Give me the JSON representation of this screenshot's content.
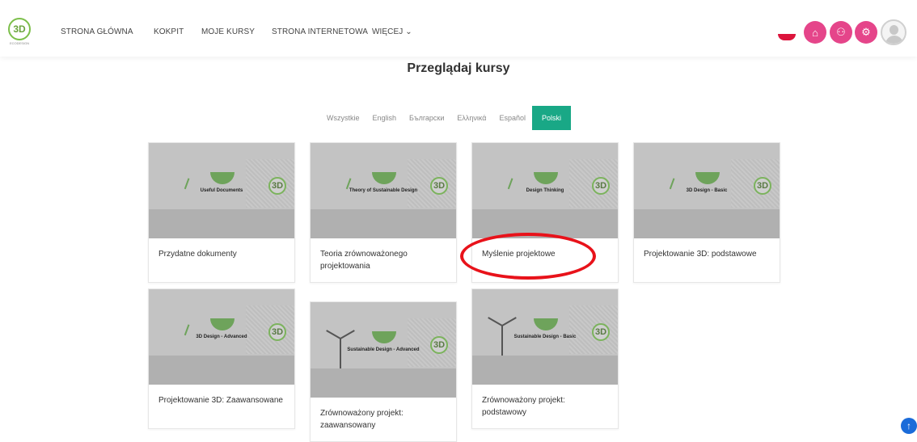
{
  "logo": {
    "text": "3D",
    "tagline": "ECODESIGN"
  },
  "nav": {
    "home": "STRONA GŁÓWNA",
    "dashboard": "KOKPIT",
    "my_courses": "MOJE KURSY",
    "website": "STRONA INTERNETOWA",
    "more": "WIĘCEJ ⌄"
  },
  "header_icons": {
    "language_flag": "poland-flag-icon",
    "btn1": "⌂",
    "btn2": "⚇",
    "btn3": "⚙",
    "btn1_icon": "cube-icon",
    "btn2_icon": "link-icon",
    "btn3_icon": "settings-icon",
    "accent": "#e5458a"
  },
  "page_title": "Przeglądaj kursy",
  "filters": [
    {
      "label": "Wszystkie",
      "active": false
    },
    {
      "label": "English",
      "active": false
    },
    {
      "label": "Български",
      "active": false
    },
    {
      "label": "Ελληνικά",
      "active": false
    },
    {
      "label": "Español",
      "active": false
    },
    {
      "label": "Polski",
      "active": true
    }
  ],
  "filter_accent": "#19a886",
  "courses": [
    {
      "thumb_text": "Useful Documents",
      "title": "Przydatne dokumenty"
    },
    {
      "thumb_text": "Theory of Sustainable Design",
      "title": "Teoria zrównoważonego projektowania"
    },
    {
      "thumb_text": "Design Thinking",
      "title": "Myślenie projektowe"
    },
    {
      "thumb_text": "3D Design - Basic",
      "title": "Projektowanie 3D: podstawowe"
    },
    {
      "thumb_text": "3D Design - Advanced",
      "title": "Projektowanie 3D: Zaawansowane"
    },
    {
      "thumb_text": "Sustainable Design - Advanced",
      "title": "Zrównoważony projekt: zaawansowany"
    },
    {
      "thumb_text": "Sustainable Design - Basic",
      "title": "Zrównoważony projekt: podstawowy"
    }
  ],
  "scroll_top": "↑"
}
